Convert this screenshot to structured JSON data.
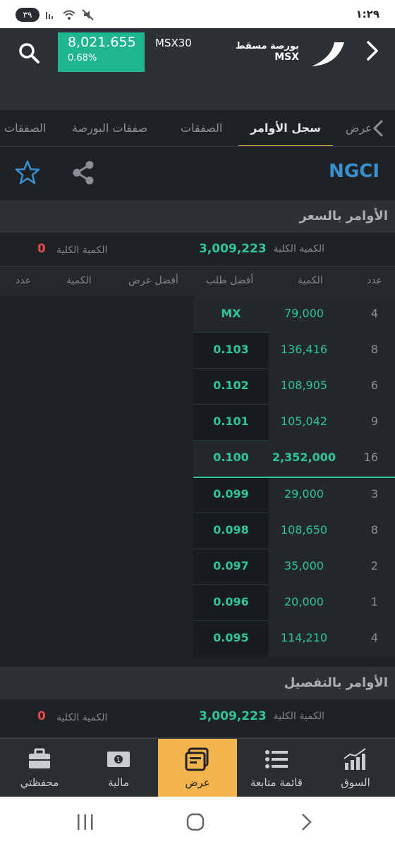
{
  "status": {
    "badge": "٣٩",
    "time": "١:٢٩"
  },
  "header": {
    "index_value": "8,021.655",
    "index_change": "0.68%",
    "index_name": "MSX30",
    "brand_ar": "بورصة مسقط",
    "brand_en": "MSX"
  },
  "tabs": [
    "الصفقات",
    "صفقات البورصة",
    "الصفقات",
    "سجل الأوامر",
    "عرض"
  ],
  "stock": {
    "symbol": "NGCI"
  },
  "price_section": {
    "title": "الأوامر بالسعر",
    "total_label": "الكمية الكلية",
    "bid_total": "3,009,223",
    "ask_total_label": "الكمية الكلية",
    "ask_total": "0"
  },
  "columns": [
    "عدد",
    "الكمية",
    "أفضل طلب",
    "أفضل عرض",
    "الكمية",
    "عدد"
  ],
  "orders": [
    {
      "count": "4",
      "qty": "79,000",
      "price": "MX"
    },
    {
      "count": "8",
      "qty": "136,416",
      "price": "0.103"
    },
    {
      "count": "6",
      "qty": "108,905",
      "price": "0.102"
    },
    {
      "count": "9",
      "qty": "105,042",
      "price": "0.101"
    },
    {
      "count": "16",
      "qty": "2,352,000",
      "price": "0.100"
    },
    {
      "count": "3",
      "qty": "29,000",
      "price": "0.099"
    },
    {
      "count": "8",
      "qty": "108,650",
      "price": "0.098"
    },
    {
      "count": "2",
      "qty": "35,000",
      "price": "0.097"
    },
    {
      "count": "1",
      "qty": "20,000",
      "price": "0.096"
    },
    {
      "count": "4",
      "qty": "114,210",
      "price": "0.095"
    }
  ],
  "detail_section": {
    "title": "الأوامر بالتفصيل",
    "total_label": "الكمية الكلية",
    "bid_total": "3,009,223",
    "ask_total_label": "الكمية الكلية",
    "ask_total": "0"
  },
  "nav": [
    "محفظتي",
    "مالية",
    "عرض",
    "قائمة متابعة",
    "السوق"
  ],
  "colors": {
    "accent": "#f3b44c",
    "green": "#2ec59c",
    "red": "#e24b4b",
    "brand_blue": "#3a8fd0"
  }
}
